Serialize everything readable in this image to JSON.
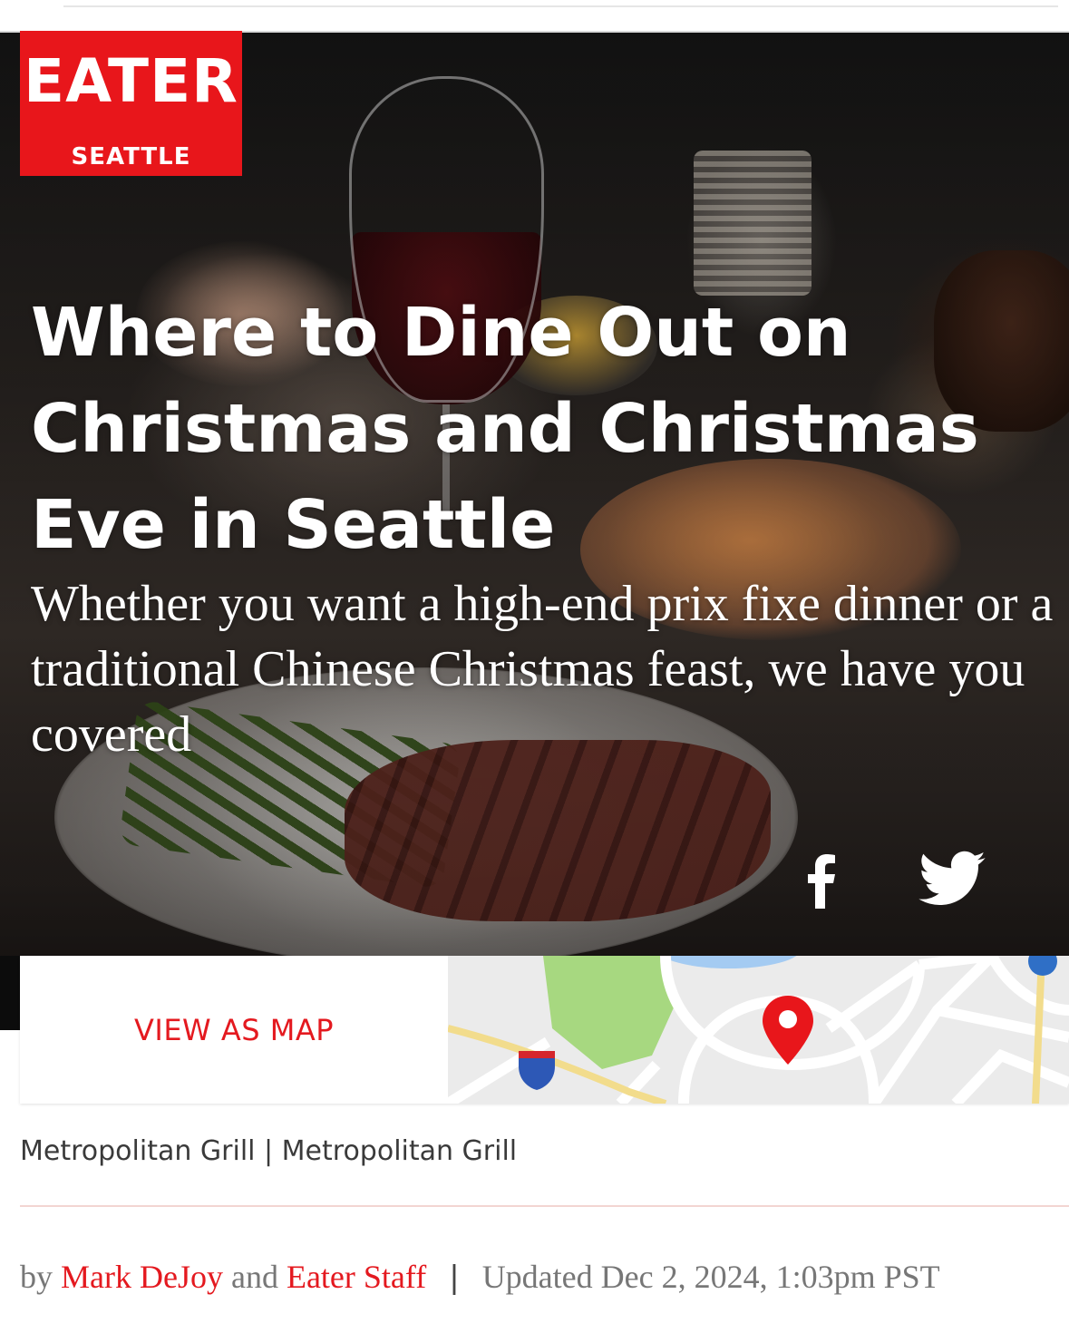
{
  "brand": {
    "name": "EATER",
    "city": "SEATTLE",
    "accent_color": "#e8161b"
  },
  "article": {
    "title": "Where to Dine Out on Christmas and Christmas Eve in Seattle",
    "dek": "Whether you want a high-end prix fixe dinner or a traditional Chinese Christmas feast, we have you covered",
    "image_caption": "Metropolitan Grill | Metropolitan Grill"
  },
  "share": {
    "facebook_icon": "facebook-icon",
    "twitter_icon": "twitter-icon"
  },
  "map": {
    "button_label": "VIEW AS MAP",
    "pin_icon": "map-pin-icon",
    "highway_shield_icon": "interstate-shield-icon",
    "pin_color": "#e8161b"
  },
  "byline": {
    "prefix": "by",
    "author_1": "Mark DeJoy",
    "conjunction": "and",
    "author_2": "Eater Staff",
    "separator": "|",
    "updated": "Updated Dec 2, 2024, 1:03pm PST"
  }
}
